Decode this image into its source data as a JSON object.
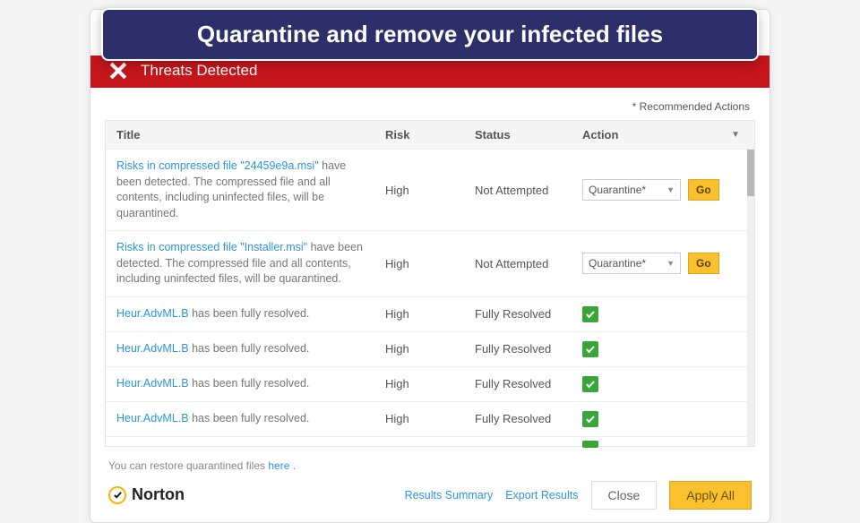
{
  "banner": {
    "title": "Quarantine and remove your infected files"
  },
  "header": {
    "title": "Threats Detected"
  },
  "notes": {
    "recommended": "* Recommended Actions",
    "restore_prefix": "You can restore quarantined files ",
    "restore_link": "here",
    "restore_suffix": " ."
  },
  "columns": {
    "title": "Title",
    "risk": "Risk",
    "status": "Status",
    "action": "Action"
  },
  "rows": [
    {
      "link": "Risks in compressed file \"24459e9a.msi\"",
      "rest": " have been detected. The compressed file and all contents, including uninfected files, will be quarantined.",
      "risk": "High",
      "status": "Not Attempted",
      "action_type": "select",
      "action_value": "Quarantine*",
      "go": "Go"
    },
    {
      "link": "Risks in compressed file \"Installer.msi\"",
      "rest": " have been detected. The compressed file and all contents, including uninfected files, will be quarantined.",
      "risk": "High",
      "status": "Not Attempted",
      "action_type": "select",
      "action_value": "Quarantine*",
      "go": "Go"
    },
    {
      "link": "Heur.AdvML.B",
      "rest": " has been fully resolved.",
      "risk": "High",
      "status": "Fully Resolved",
      "action_type": "check"
    },
    {
      "link": "Heur.AdvML.B",
      "rest": " has been fully resolved.",
      "risk": "High",
      "status": "Fully Resolved",
      "action_type": "check"
    },
    {
      "link": "Heur.AdvML.B",
      "rest": " has been fully resolved.",
      "risk": "High",
      "status": "Fully Resolved",
      "action_type": "check"
    },
    {
      "link": "Heur.AdvML.B",
      "rest": " has been fully resolved.",
      "risk": "High",
      "status": "Fully Resolved",
      "action_type": "check"
    }
  ],
  "footer": {
    "brand": "Norton",
    "links": {
      "summary": "Results Summary",
      "export": "Export Results"
    },
    "close": "Close",
    "apply": "Apply All"
  }
}
